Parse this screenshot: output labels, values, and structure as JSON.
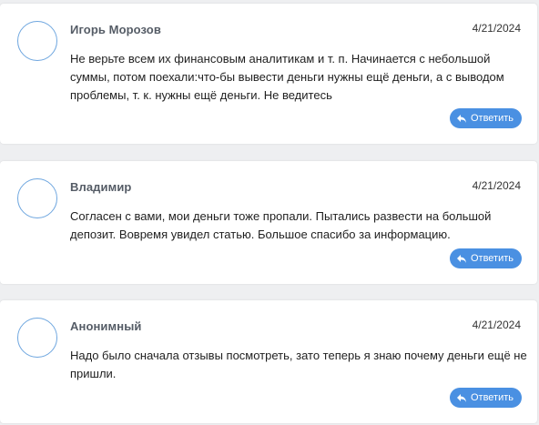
{
  "comments": [
    {
      "author": "Игорь Морозов",
      "date": "4/21/2024",
      "text": "Не верьте всем их финансовым аналитикам и т. п. Начинается с небольшой суммы, потом поехали:что-бы вывести деньги нужны ещё деньги, а с выводом проблемы, т. к. нужны ещё деньги. Не ведитесь",
      "reply_label": "Ответить",
      "reply_icon": "reply-arrow-icon"
    },
    {
      "author": "Владимир",
      "date": "4/21/2024",
      "text": "Согласен с вами, мои деньги тоже пропали. Пытались развести на большой депозит. Вовремя увидел статью. Большое спасибо за информацию.",
      "reply_label": "Ответить",
      "reply_icon": "reply-arrow-icon"
    },
    {
      "author": "Анонимный",
      "date": "4/21/2024",
      "text": "Надо было сначала отзывы посмотреть, зато теперь я знаю почему деньги ещё не пришли.",
      "reply_label": "Ответить",
      "reply_icon": "reply-arrow-icon"
    }
  ],
  "colors": {
    "accent": "#4a90e2",
    "avatar_border": "#6ea6df",
    "author": "#555c66",
    "background": "#eeeff1",
    "card": "#ffffff"
  }
}
